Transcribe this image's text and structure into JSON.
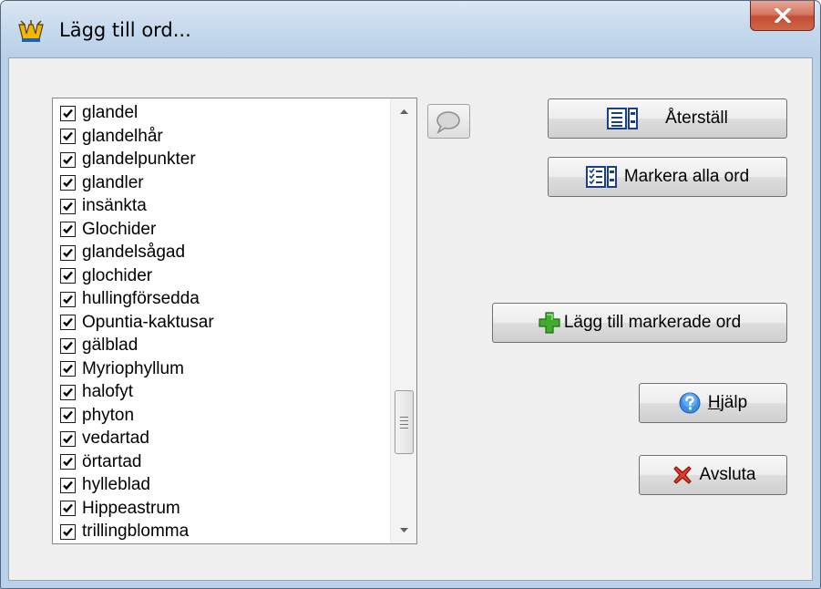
{
  "window": {
    "title": "Lägg till ord..."
  },
  "words": [
    {
      "label": "glandel",
      "checked": true
    },
    {
      "label": "glandelhår",
      "checked": true
    },
    {
      "label": "glandelpunkter",
      "checked": true
    },
    {
      "label": "glandler",
      "checked": true
    },
    {
      "label": "insänkta",
      "checked": true
    },
    {
      "label": "Glochider",
      "checked": true
    },
    {
      "label": "glandelsågad",
      "checked": true
    },
    {
      "label": "glochider",
      "checked": true
    },
    {
      "label": "hullingförsedda",
      "checked": true
    },
    {
      "label": "Opuntia-kaktusar",
      "checked": true
    },
    {
      "label": "gälblad",
      "checked": true
    },
    {
      "label": "Myriophyllum",
      "checked": true
    },
    {
      "label": "halofyt",
      "checked": true
    },
    {
      "label": "phyton",
      "checked": true
    },
    {
      "label": "vedartad",
      "checked": true
    },
    {
      "label": "örtartad",
      "checked": true
    },
    {
      "label": "hylleblad",
      "checked": true
    },
    {
      "label": "Hippeastrum",
      "checked": true
    },
    {
      "label": "trillingblomma",
      "checked": true
    }
  ],
  "buttons": {
    "reset": "Återställ",
    "select_all": "Markera alla ord",
    "add_selected": "Lägg till markerade ord",
    "help_prefix": "H",
    "help_rest": "jälp",
    "quit": "Avsluta"
  },
  "icons": {
    "title": "app-logo-icon",
    "close": "close-icon",
    "comment": "speech-bubble-icon",
    "reset": "list-icon",
    "select_all": "checklist-icon",
    "add": "green-plus-icon",
    "help": "help-icon",
    "quit": "red-x-icon"
  },
  "colors": {
    "titlebar": "#c6d9ed",
    "close_button": "#c7533a",
    "dialog_bg": "#f0f0f0"
  }
}
